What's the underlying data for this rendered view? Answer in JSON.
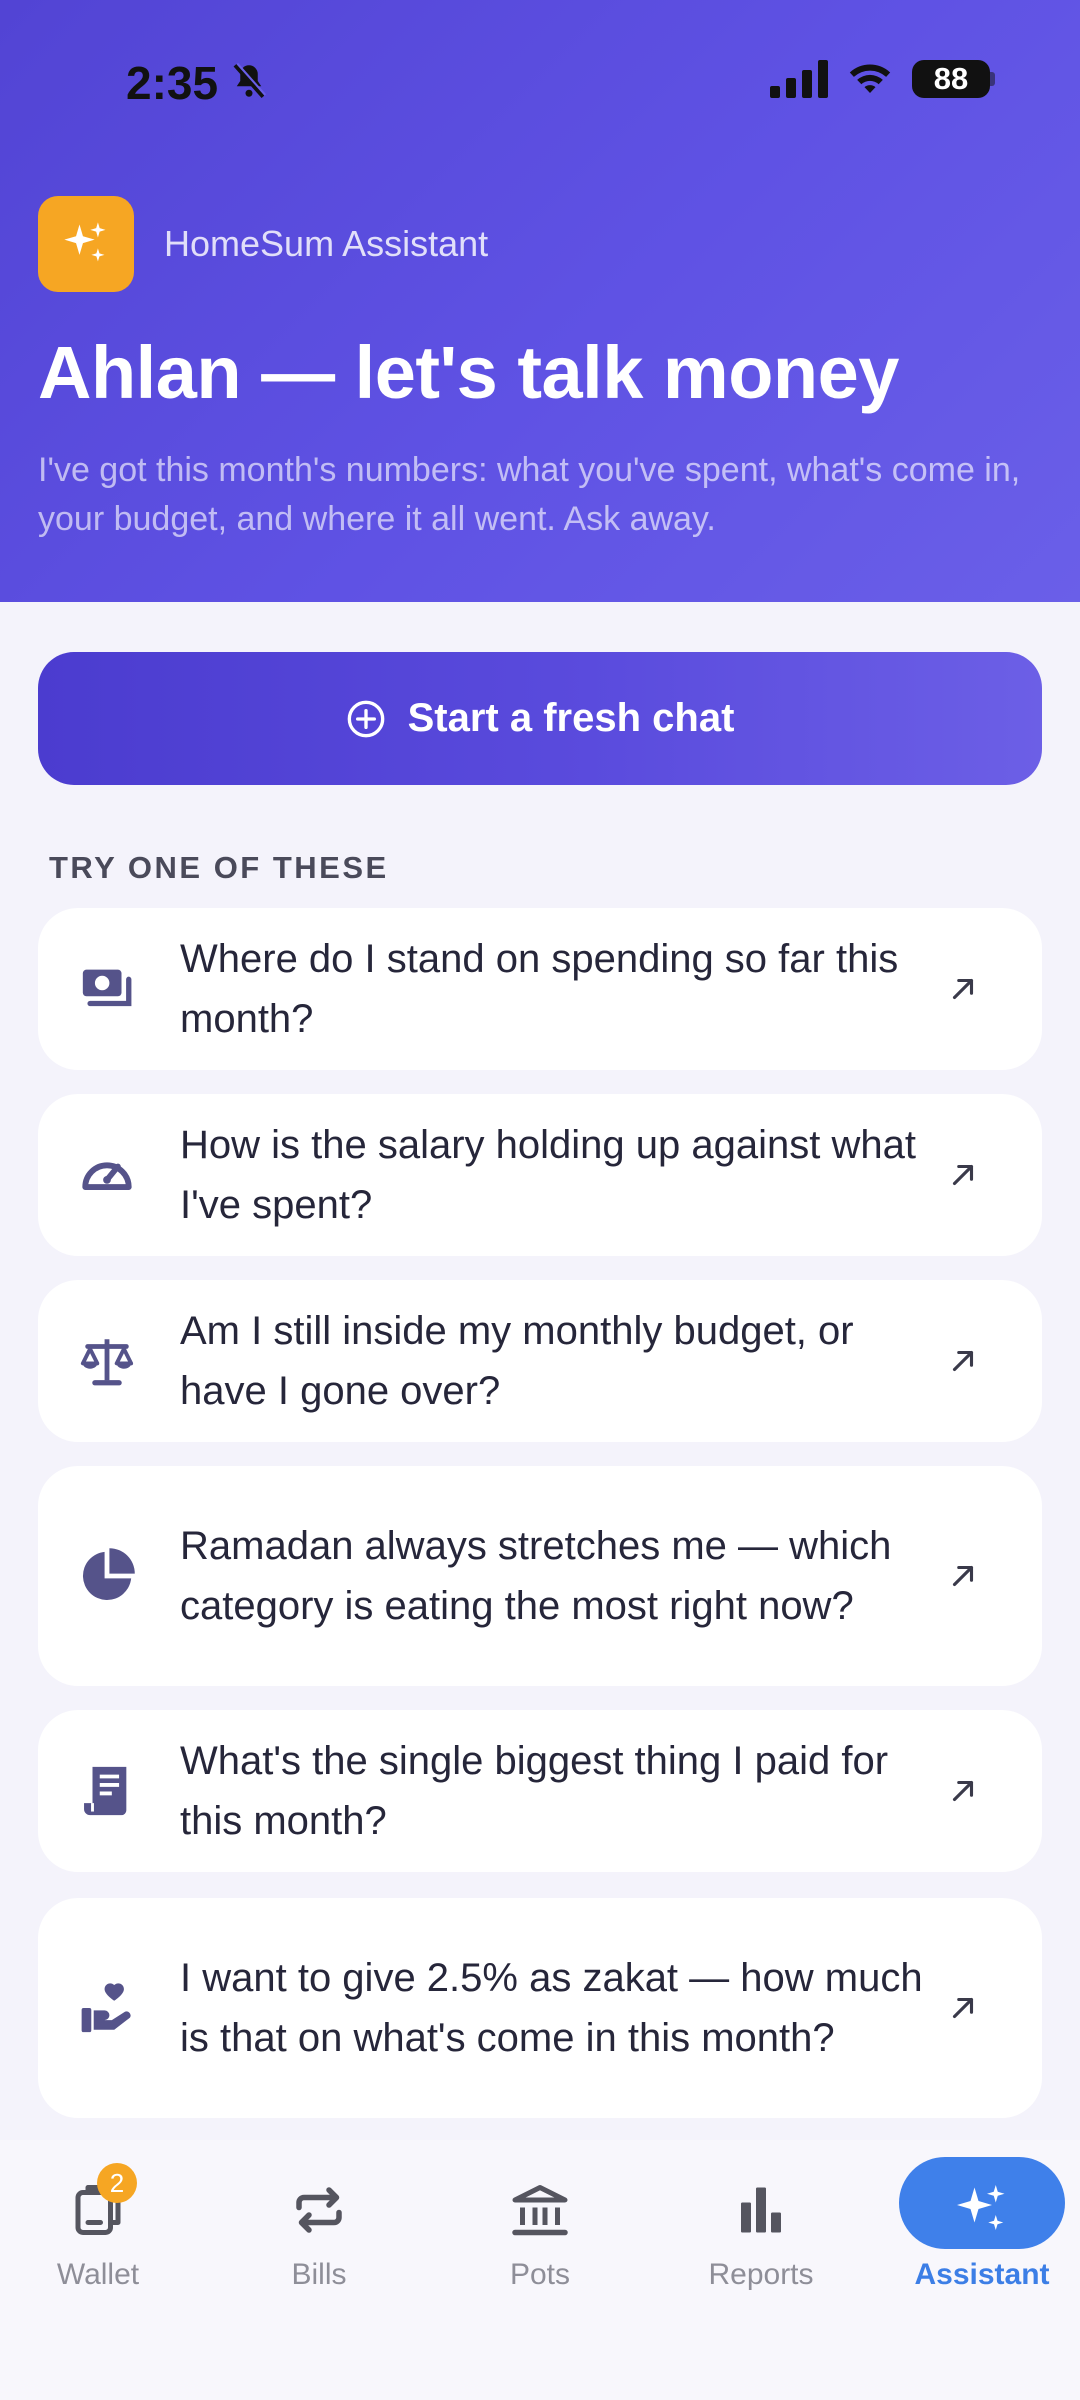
{
  "status_bar": {
    "time": "2:35",
    "battery": "88"
  },
  "header": {
    "app_name": "HomeSum Assistant",
    "title": "Ahlan — let's talk money",
    "subtitle": "I've got this month's numbers: what you've spent, what's come in, your budget, and where it all went. Ask away."
  },
  "actions": {
    "start_chat_label": "Start a fresh chat"
  },
  "suggestions": {
    "section_label": "TRY ONE OF THESE",
    "items": [
      {
        "icon": "money-icon",
        "text": "Where do I stand on spending so far this month?"
      },
      {
        "icon": "gauge-icon",
        "text": "How is the salary holding up against what I've spent?"
      },
      {
        "icon": "scale-icon",
        "text": "Am I still inside my monthly budget, or have I gone over?"
      },
      {
        "icon": "pie-chart-icon",
        "text": "Ramadan always stretches me — which category is eating the most right now?"
      },
      {
        "icon": "receipt-icon",
        "text": "What's the single biggest thing I paid for this month?"
      },
      {
        "icon": "hand-heart-icon",
        "text": "I want to give 2.5% as zakat — how much is that on what's come in this month?"
      }
    ]
  },
  "nav": {
    "items": [
      {
        "label": "Wallet",
        "icon": "wallet-icon",
        "badge": "2"
      },
      {
        "label": "Bills",
        "icon": "repeat-icon"
      },
      {
        "label": "Pots",
        "icon": "bank-icon"
      },
      {
        "label": "Reports",
        "icon": "bar-chart-icon"
      },
      {
        "label": "Assistant",
        "icon": "sparkles-icon",
        "active": true
      }
    ]
  },
  "colors": {
    "header_gradient_start": "#5244d4",
    "accent_orange": "#f6a623",
    "active_blue": "#3f80ea",
    "icon_purple": "#55538a"
  }
}
